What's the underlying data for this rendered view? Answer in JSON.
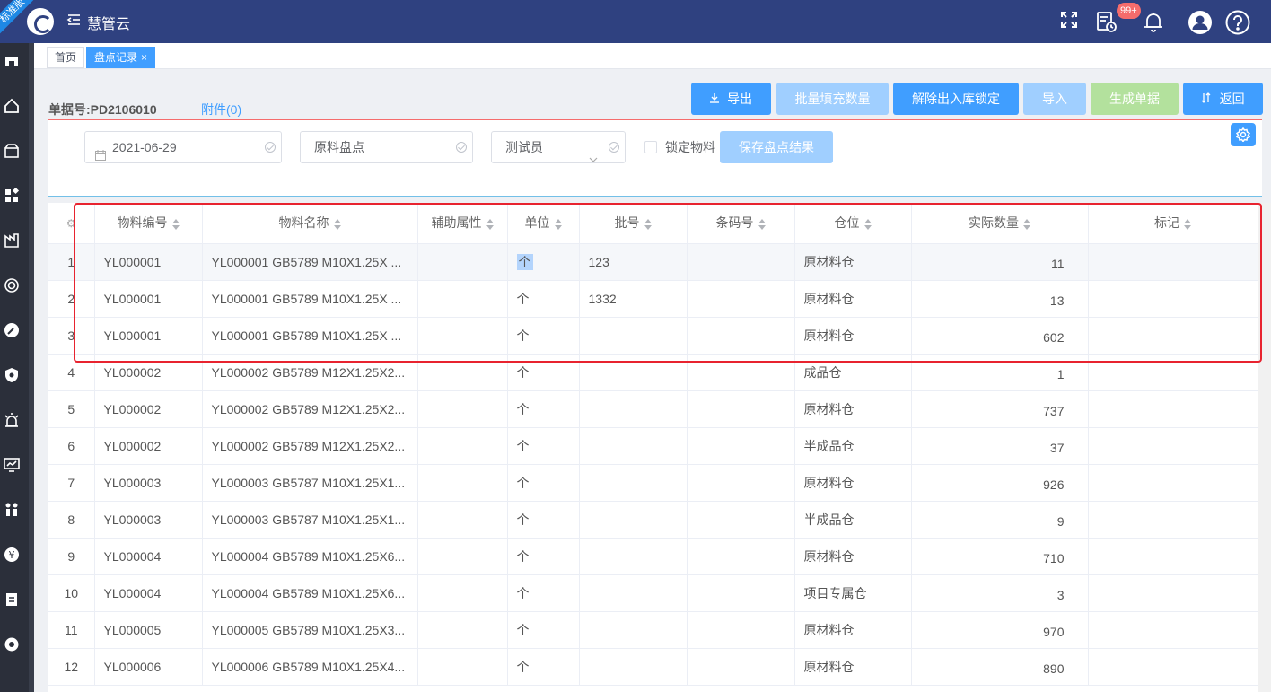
{
  "header": {
    "corner_badge": "标准版",
    "app_title": "慧管云",
    "notification_count": "99+"
  },
  "tabs": [
    {
      "label": "首页",
      "active": false
    },
    {
      "label": "盘点记录",
      "active": true,
      "close": "×"
    }
  ],
  "doc": {
    "number_label": "单据号:PD2106010",
    "attachment": "附件(0)"
  },
  "buttons": {
    "export": "导出",
    "batch_fill": "批量填充数量",
    "unlock": "解除出入库锁定",
    "import": "导入",
    "generate": "生成单据",
    "back": "返回"
  },
  "filter": {
    "date": "2021-06-29",
    "category": "原料盘点",
    "user": "测试员",
    "lock_label": "锁定物料",
    "save_label": "保存盘点结果"
  },
  "table": {
    "columns": [
      "物料编号",
      "物料名称",
      "辅助属性",
      "单位",
      "批号",
      "条码号",
      "仓位",
      "实际数量",
      "标记"
    ],
    "rows": [
      {
        "idx": "1",
        "code": "YL000001",
        "name": "YL000001 GB5789 M10X1.25X ...",
        "attr": "",
        "unit": "个",
        "batch": "123",
        "barcode": "",
        "location": "原材料仓",
        "qty": "11",
        "mark": ""
      },
      {
        "idx": "2",
        "code": "YL000001",
        "name": "YL000001 GB5789 M10X1.25X ...",
        "attr": "",
        "unit": "个",
        "batch": "1332",
        "barcode": "",
        "location": "原材料仓",
        "qty": "13",
        "mark": ""
      },
      {
        "idx": "3",
        "code": "YL000001",
        "name": "YL000001 GB5789 M10X1.25X ...",
        "attr": "",
        "unit": "个",
        "batch": "",
        "barcode": "",
        "location": "原材料仓",
        "qty": "602",
        "mark": ""
      },
      {
        "idx": "4",
        "code": "YL000002",
        "name": "YL000002 GB5789 M12X1.25X2...",
        "attr": "",
        "unit": "个",
        "batch": "",
        "barcode": "",
        "location": "成品仓",
        "qty": "1",
        "mark": ""
      },
      {
        "idx": "5",
        "code": "YL000002",
        "name": "YL000002 GB5789 M12X1.25X2...",
        "attr": "",
        "unit": "个",
        "batch": "",
        "barcode": "",
        "location": "原材料仓",
        "qty": "737",
        "mark": ""
      },
      {
        "idx": "6",
        "code": "YL000002",
        "name": "YL000002 GB5789 M12X1.25X2...",
        "attr": "",
        "unit": "个",
        "batch": "",
        "barcode": "",
        "location": "半成品仓",
        "qty": "37",
        "mark": ""
      },
      {
        "idx": "7",
        "code": "YL000003",
        "name": "YL000003 GB5787 M10X1.25X1...",
        "attr": "",
        "unit": "个",
        "batch": "",
        "barcode": "",
        "location": "原材料仓",
        "qty": "926",
        "mark": ""
      },
      {
        "idx": "8",
        "code": "YL000003",
        "name": "YL000003 GB5787 M10X1.25X1...",
        "attr": "",
        "unit": "个",
        "batch": "",
        "barcode": "",
        "location": "半成品仓",
        "qty": "9",
        "mark": ""
      },
      {
        "idx": "9",
        "code": "YL000004",
        "name": "YL000004 GB5789 M10X1.25X6...",
        "attr": "",
        "unit": "个",
        "batch": "",
        "barcode": "",
        "location": "原材料仓",
        "qty": "710",
        "mark": ""
      },
      {
        "idx": "10",
        "code": "YL000004",
        "name": "YL000004 GB5789 M10X1.25X6...",
        "attr": "",
        "unit": "个",
        "batch": "",
        "barcode": "",
        "location": "项目专属仓",
        "qty": "3",
        "mark": ""
      },
      {
        "idx": "11",
        "code": "YL000005",
        "name": "YL000005 GB5789 M10X1.25X3...",
        "attr": "",
        "unit": "个",
        "batch": "",
        "barcode": "",
        "location": "原材料仓",
        "qty": "970",
        "mark": ""
      },
      {
        "idx": "12",
        "code": "YL000006",
        "name": "YL000006 GB5789 M10X1.25X4...",
        "attr": "",
        "unit": "个",
        "batch": "",
        "barcode": "",
        "location": "原材料仓",
        "qty": "890",
        "mark": ""
      }
    ]
  },
  "colors": {
    "header_bg": "#2f4180",
    "sidebar_bg": "#2b2f3a",
    "primary": "#409eff",
    "primary_disabled": "#a0cfff",
    "success_disabled": "#b3e19d",
    "highlight_border": "#e8232f"
  }
}
